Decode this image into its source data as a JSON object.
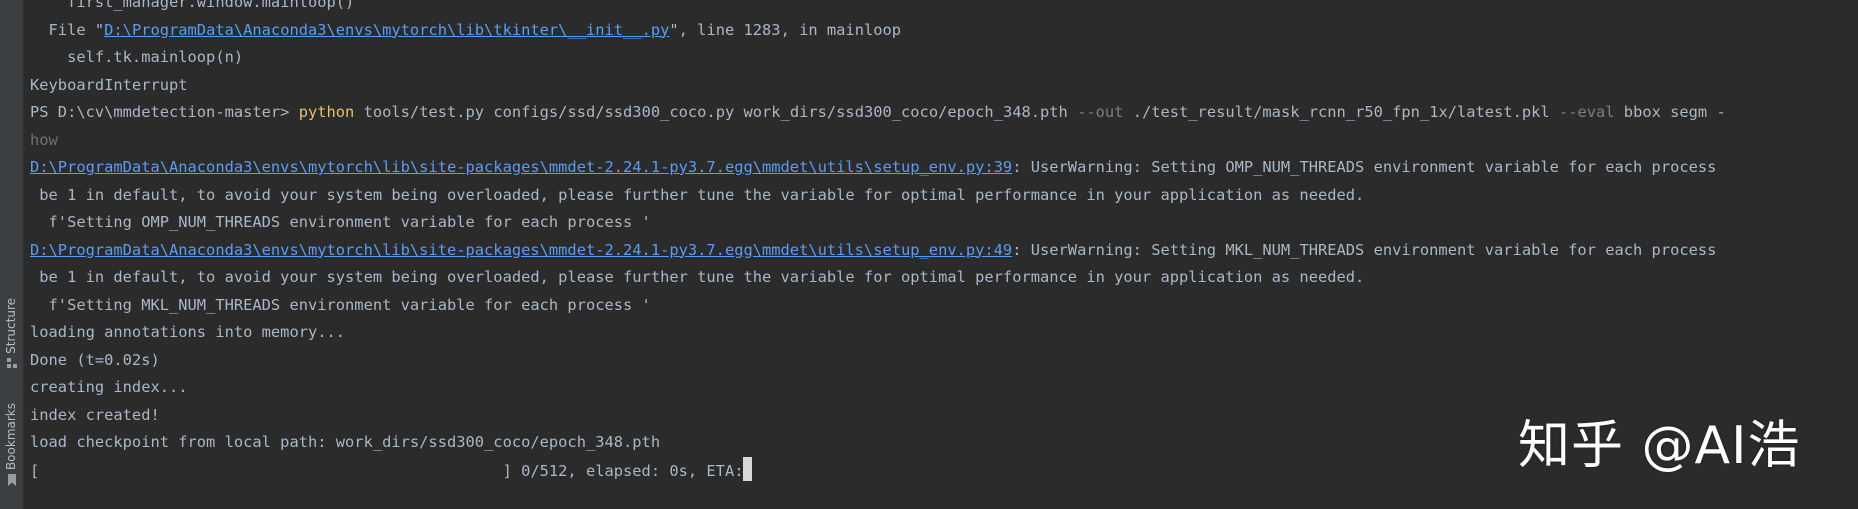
{
  "sidebar": {
    "structure_label": "Structure",
    "bookmarks_label": "Bookmarks"
  },
  "terminal": {
    "lines": [
      {
        "segments": [
          {
            "text": "    first_manager.window.mainloop()",
            "style": "plain"
          }
        ]
      },
      {
        "segments": [
          {
            "text": "  File \"",
            "style": "plain"
          },
          {
            "text": "D:\\ProgramData\\Anaconda3\\envs\\mytorch\\lib\\tkinter\\__init__.py",
            "style": "link"
          },
          {
            "text": "\", line 1283, in mainloop",
            "style": "plain"
          }
        ]
      },
      {
        "segments": [
          {
            "text": "    self.tk.mainloop(n)",
            "style": "plain"
          }
        ]
      },
      {
        "segments": [
          {
            "text": "KeyboardInterrupt",
            "style": "plain"
          }
        ]
      },
      {
        "segments": [
          {
            "text": "PS D:\\cv\\mmdetection-master> ",
            "style": "plain"
          },
          {
            "text": "python",
            "style": "cmd"
          },
          {
            "text": " tools/test.py configs/ssd/ssd300_coco.py work_dirs/ssd300_coco/epoch_348.pth ",
            "style": "plain"
          },
          {
            "text": "--out",
            "style": "opt"
          },
          {
            "text": " ./test_result/mask_rcnn_r50_fpn_1x/latest.pkl ",
            "style": "plain"
          },
          {
            "text": "--eval",
            "style": "opt"
          },
          {
            "text": " bbox segm -",
            "style": "plain"
          }
        ]
      },
      {
        "segments": [
          {
            "text": "how",
            "style": "dim"
          }
        ]
      },
      {
        "segments": [
          {
            "text": "D:\\ProgramData\\Anaconda3\\envs\\mytorch\\lib\\site-packages\\mmdet-2.24.1-py3.7.egg\\mmdet\\utils\\setup_env.py:39",
            "style": "link"
          },
          {
            "text": ": UserWarning: Setting OMP_NUM_THREADS environment variable for each process",
            "style": "plain"
          }
        ]
      },
      {
        "segments": [
          {
            "text": " be 1 in default, to avoid your system being overloaded, please further tune the variable for optimal performance in your application as needed.",
            "style": "plain"
          }
        ]
      },
      {
        "segments": [
          {
            "text": "  f'Setting OMP_NUM_THREADS environment variable for each process '",
            "style": "plain"
          }
        ]
      },
      {
        "segments": [
          {
            "text": "D:\\ProgramData\\Anaconda3\\envs\\mytorch\\lib\\site-packages\\mmdet-2.24.1-py3.7.egg\\mmdet\\utils\\setup_env.py:49",
            "style": "link"
          },
          {
            "text": ": UserWarning: Setting MKL_NUM_THREADS environment variable for each process",
            "style": "plain"
          }
        ]
      },
      {
        "segments": [
          {
            "text": " be 1 in default, to avoid your system being overloaded, please further tune the variable for optimal performance in your application as needed.",
            "style": "plain"
          }
        ]
      },
      {
        "segments": [
          {
            "text": "  f'Setting MKL_NUM_THREADS environment variable for each process '",
            "style": "plain"
          }
        ]
      },
      {
        "segments": [
          {
            "text": "loading annotations into memory...",
            "style": "plain"
          }
        ]
      },
      {
        "segments": [
          {
            "text": "Done (t=0.02s)",
            "style": "plain"
          }
        ]
      },
      {
        "segments": [
          {
            "text": "creating index...",
            "style": "plain"
          }
        ]
      },
      {
        "segments": [
          {
            "text": "index created!",
            "style": "plain"
          }
        ]
      },
      {
        "segments": [
          {
            "text": "load checkpoint from local path: work_dirs/ssd300_coco/epoch_348.pth",
            "style": "plain"
          }
        ]
      },
      {
        "segments": [
          {
            "text": "[                                                  ] 0/512, elapsed: 0s, ETA:",
            "style": "plain"
          }
        ],
        "cursor": true
      }
    ]
  },
  "watermark": {
    "text": "知乎 @AI浩"
  },
  "colors": {
    "background": "#2b2b2b",
    "text": "#a9b7c6",
    "link": "#589df6",
    "command": "#e8bf6a",
    "option": "#7a7e85"
  }
}
